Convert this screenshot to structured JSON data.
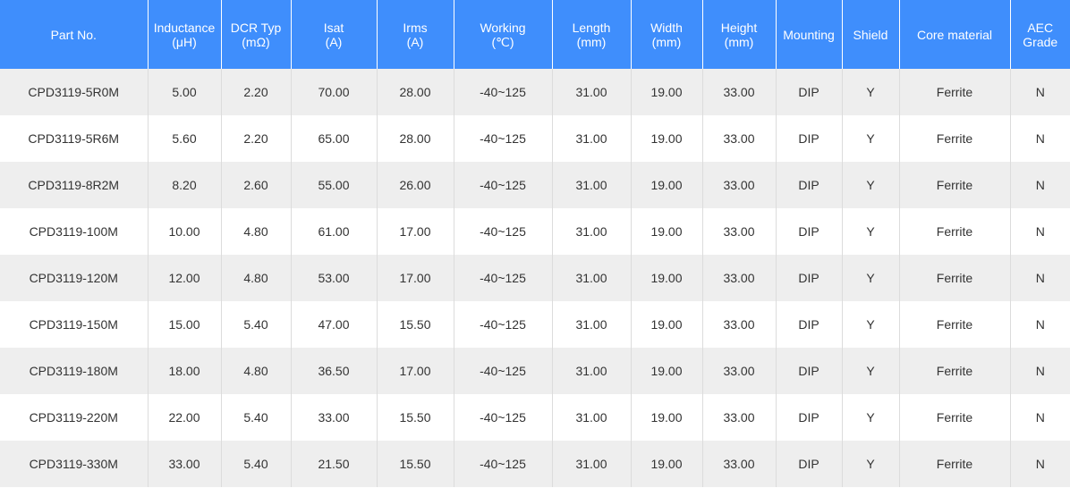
{
  "table": {
    "headers": [
      {
        "line1": "Part No.",
        "line2": ""
      },
      {
        "line1": "Inductance",
        "line2": "(μH)"
      },
      {
        "line1": "DCR Typ",
        "line2": "(mΩ)"
      },
      {
        "line1": "Isat",
        "line2": "(A)"
      },
      {
        "line1": "Irms",
        "line2": "(A)"
      },
      {
        "line1": "Working",
        "line2": "(℃)"
      },
      {
        "line1": "Length",
        "line2": "(mm)"
      },
      {
        "line1": "Width",
        "line2": "(mm)"
      },
      {
        "line1": "Height",
        "line2": "(mm)"
      },
      {
        "line1": "Mounting",
        "line2": ""
      },
      {
        "line1": "Shield",
        "line2": ""
      },
      {
        "line1": "Core material",
        "line2": ""
      },
      {
        "line1": "AEC",
        "line2": "Grade"
      }
    ],
    "rows": [
      [
        "CPD3119-5R0M",
        "5.00",
        "2.20",
        "70.00",
        "28.00",
        "-40~125",
        "31.00",
        "19.00",
        "33.00",
        "DIP",
        "Y",
        "Ferrite",
        "N"
      ],
      [
        "CPD3119-5R6M",
        "5.60",
        "2.20",
        "65.00",
        "28.00",
        "-40~125",
        "31.00",
        "19.00",
        "33.00",
        "DIP",
        "Y",
        "Ferrite",
        "N"
      ],
      [
        "CPD3119-8R2M",
        "8.20",
        "2.60",
        "55.00",
        "26.00",
        "-40~125",
        "31.00",
        "19.00",
        "33.00",
        "DIP",
        "Y",
        "Ferrite",
        "N"
      ],
      [
        "CPD3119-100M",
        "10.00",
        "4.80",
        "61.00",
        "17.00",
        "-40~125",
        "31.00",
        "19.00",
        "33.00",
        "DIP",
        "Y",
        "Ferrite",
        "N"
      ],
      [
        "CPD3119-120M",
        "12.00",
        "4.80",
        "53.00",
        "17.00",
        "-40~125",
        "31.00",
        "19.00",
        "33.00",
        "DIP",
        "Y",
        "Ferrite",
        "N"
      ],
      [
        "CPD3119-150M",
        "15.00",
        "5.40",
        "47.00",
        "15.50",
        "-40~125",
        "31.00",
        "19.00",
        "33.00",
        "DIP",
        "Y",
        "Ferrite",
        "N"
      ],
      [
        "CPD3119-180M",
        "18.00",
        "4.80",
        "36.50",
        "17.00",
        "-40~125",
        "31.00",
        "19.00",
        "33.00",
        "DIP",
        "Y",
        "Ferrite",
        "N"
      ],
      [
        "CPD3119-220M",
        "22.00",
        "5.40",
        "33.00",
        "15.50",
        "-40~125",
        "31.00",
        "19.00",
        "33.00",
        "DIP",
        "Y",
        "Ferrite",
        "N"
      ],
      [
        "CPD3119-330M",
        "33.00",
        "5.40",
        "21.50",
        "15.50",
        "-40~125",
        "31.00",
        "19.00",
        "33.00",
        "DIP",
        "Y",
        "Ferrite",
        "N"
      ]
    ]
  },
  "colors": {
    "header_bg": "#3f8efc",
    "header_text": "#ffffff",
    "row_odd_bg": "#eeeeee",
    "row_even_bg": "#ffffff",
    "cell_text": "#333333"
  }
}
